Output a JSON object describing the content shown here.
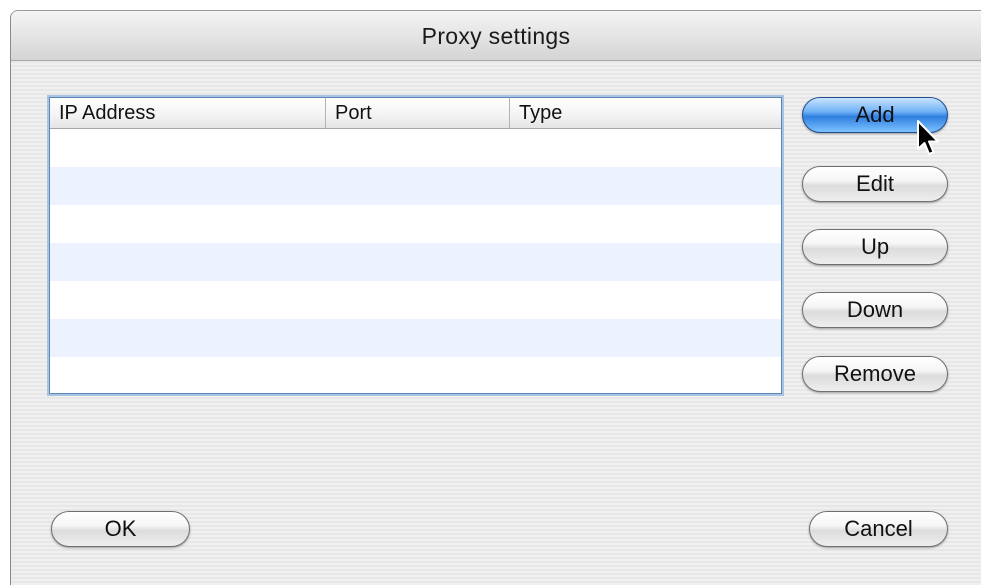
{
  "window": {
    "title": "Proxy settings"
  },
  "table": {
    "columns": [
      "IP Address",
      "Port",
      "Type"
    ],
    "rows": []
  },
  "buttons": {
    "add": "Add",
    "edit": "Edit",
    "up": "Up",
    "down": "Down",
    "remove": "Remove",
    "ok": "OK",
    "cancel": "Cancel"
  },
  "colors": {
    "default_button": "#5aa6f2",
    "stripe": "#edf3fe",
    "list_border": "#5b86b8"
  },
  "icons": {
    "cursor": "arrow-cursor-icon"
  }
}
